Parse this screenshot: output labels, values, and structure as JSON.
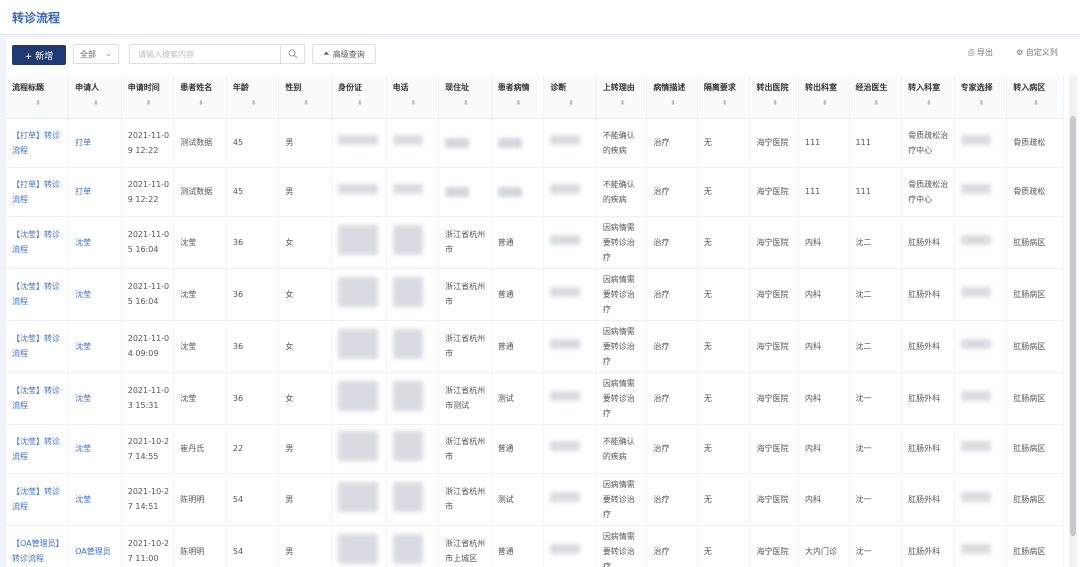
{
  "page": {
    "title": "转诊流程"
  },
  "toolbar": {
    "new_label": "+ 新增",
    "filter_value": "全部",
    "search_placeholder": "请输入搜索内容",
    "advanced_label": "高级查询",
    "export_label": "导出",
    "custom_columns_label": "自定义列"
  },
  "columns": [
    "流程标题",
    "申请人",
    "申请时间",
    "患者姓名",
    "年龄",
    "性别",
    "身份证",
    "电话",
    "现住址",
    "患者病情",
    "诊断",
    "上转理由",
    "病情描述",
    "隔离要求",
    "转出医院",
    "转出科室",
    "经治医生",
    "转入科室",
    "专家选择",
    "转入病区"
  ],
  "rows": [
    {
      "title": "【打单】转诊流程",
      "applicant": "打单",
      "time": "2021-11-09 12:22",
      "patient": "测试数据",
      "age": "45",
      "sex": "男",
      "reason": "不能确认的疾病",
      "desc": "治疗",
      "iso": "无",
      "hospital": "海宁医院",
      "dept": "111",
      "doctor": "111",
      "in_dept": "骨质疏松治疗中心",
      "in_ward": "骨质疏松"
    },
    {
      "title": "【打单】转诊流程",
      "applicant": "打单",
      "time": "2021-11-09 12:22",
      "patient": "测试数据",
      "age": "45",
      "sex": "男",
      "reason": "不能确认的疾病",
      "desc": "治疗",
      "iso": "无",
      "hospital": "海宁医院",
      "dept": "111",
      "doctor": "111",
      "in_dept": "骨质疏松治疗中心",
      "in_ward": "骨质疏松"
    },
    {
      "title": "【沈莹】转诊流程",
      "applicant": "沈莹",
      "time": "2021-11-05 16:04",
      "patient": "沈莹",
      "age": "36",
      "sex": "女",
      "addr": "浙江省杭州市",
      "cond": "普通",
      "reason": "因病情需要转诊治疗",
      "desc": "治疗",
      "iso": "无",
      "hospital": "海宁医院",
      "dept": "内科",
      "doctor": "沈二",
      "in_dept": "肛肠外科",
      "in_ward": "肛肠病区"
    },
    {
      "title": "【沈莹】转诊流程",
      "applicant": "沈莹",
      "time": "2021-11-05 16:04",
      "patient": "沈莹",
      "age": "36",
      "sex": "女",
      "addr": "浙江省杭州市",
      "cond": "普通",
      "reason": "因病情需要转诊治疗",
      "desc": "治疗",
      "iso": "无",
      "hospital": "海宁医院",
      "dept": "内科",
      "doctor": "沈二",
      "in_dept": "肛肠外科",
      "in_ward": "肛肠病区"
    },
    {
      "title": "【沈莹】转诊流程",
      "applicant": "沈莹",
      "time": "2021-11-04 09:09",
      "patient": "沈莹",
      "age": "36",
      "sex": "女",
      "addr": "浙江省杭州市",
      "cond": "普通",
      "reason": "因病情需要转诊治疗",
      "desc": "治疗",
      "iso": "无",
      "hospital": "海宁医院",
      "dept": "内科",
      "doctor": "沈二",
      "in_dept": "肛肠外科",
      "in_ward": "肛肠病区"
    },
    {
      "title": "【沈莹】转诊流程",
      "applicant": "沈莹",
      "time": "2021-11-03 15:31",
      "patient": "沈莹",
      "age": "36",
      "sex": "女",
      "addr": "浙江省杭州市测试",
      "cond": "测试",
      "reason": "因病情需要转诊治疗",
      "desc": "治疗",
      "iso": "无",
      "hospital": "海宁医院",
      "dept": "内科",
      "doctor": "沈一",
      "in_dept": "肛肠外科",
      "in_ward": "肛肠病区"
    },
    {
      "title": "【沈莹】转诊流程",
      "applicant": "沈莹",
      "time": "2021-10-27 14:55",
      "patient": "崔丹氏",
      "age": "22",
      "sex": "男",
      "addr": "浙江省杭州市",
      "cond": "普通",
      "reason": "不能确认的疾病",
      "desc": "治疗",
      "iso": "无",
      "hospital": "海宁医院",
      "dept": "内科",
      "doctor": "沈一",
      "in_dept": "肛肠外科",
      "in_ward": "肛肠病区"
    },
    {
      "title": "【沈莹】转诊流程",
      "applicant": "沈莹",
      "time": "2021-10-27 14:51",
      "patient": "陈明明",
      "age": "54",
      "sex": "男",
      "addr": "浙江省杭州市",
      "cond": "测试",
      "reason": "因病情需要转诊治疗",
      "desc": "治疗",
      "iso": "无",
      "hospital": "海宁医院",
      "dept": "内科",
      "doctor": "沈一",
      "in_dept": "肛肠外科",
      "in_ward": "肛肠病区"
    },
    {
      "title": "【OA管理员】转诊流程",
      "applicant": "OA管理员",
      "time": "2021-10-27 11:00",
      "patient": "陈明明",
      "age": "54",
      "sex": "男",
      "addr": "浙江省杭州市上城区",
      "cond": "普通",
      "reason": "因病情需要转诊治疗",
      "desc": "治疗",
      "iso": "无",
      "hospital": "海宁医院",
      "dept": "大内门诊",
      "doctor": "沈一",
      "in_dept": "肛肠外科",
      "in_ward": "肛肠病区"
    }
  ]
}
